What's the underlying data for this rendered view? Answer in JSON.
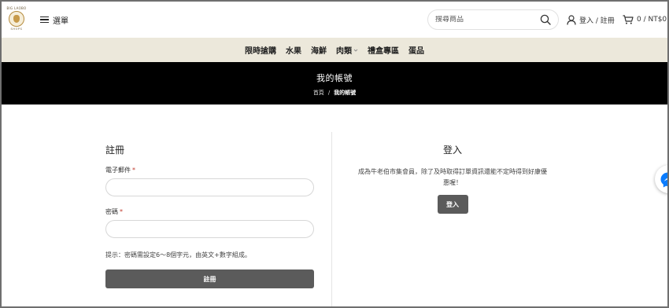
{
  "header": {
    "logo": {
      "top_text": "BIG LAOBO",
      "bottom_text": "SHOPS"
    },
    "menu_label": "選單",
    "search": {
      "placeholder": "搜尋商品"
    },
    "login_label": "登入 / 註冊",
    "cart_label": "0 / NT$0",
    "icons": {
      "search": "search-icon",
      "user": "user-icon",
      "cart": "cart-icon",
      "menu": "hamburger-icon"
    }
  },
  "nav": {
    "items": [
      {
        "label": "限時搶購"
      },
      {
        "label": "水果"
      },
      {
        "label": "海鮮"
      },
      {
        "label": "肉類",
        "has_dropdown": true
      },
      {
        "label": "禮盒專區"
      },
      {
        "label": "蛋品"
      }
    ]
  },
  "page_title": "我的帳號",
  "breadcrumb": {
    "home": "首頁",
    "separator": "/",
    "current": "我的帳號"
  },
  "register": {
    "heading": "註冊",
    "email_label": "電子郵件",
    "password_label": "密碼",
    "required_mark": "*",
    "hint": "提示：密碼需設定6～8個字元，由英文+數字組成。",
    "submit_label": "註冊"
  },
  "login": {
    "heading": "登入",
    "description_line1": "成為牛老伯市集會員，除了及時取得訂單資訊還能不定時得到好康優",
    "description_line2": "惠喔！",
    "button_label": "登入"
  },
  "colors": {
    "nav_background": "#ece8db",
    "banner_background": "#000000",
    "button_background": "#5b5b5b",
    "required": "#c0392b",
    "messenger": "#0a7cff"
  }
}
